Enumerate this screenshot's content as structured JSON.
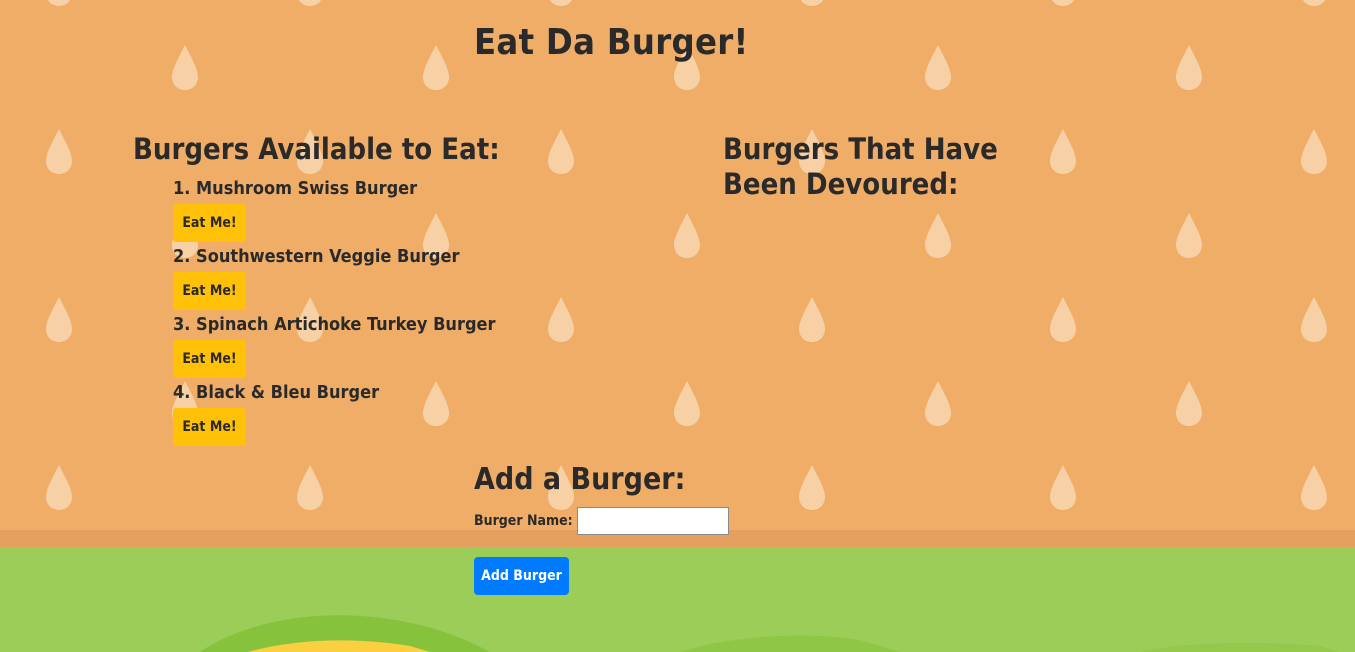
{
  "page": {
    "title": "Eat Da Burger!"
  },
  "available": {
    "heading": "Burgers Available to Eat:",
    "items": [
      {
        "name": "1. Mushroom Swiss Burger",
        "button": "Eat Me!"
      },
      {
        "name": "2. Southwestern Veggie Burger",
        "button": "Eat Me!"
      },
      {
        "name": "3. Spinach Artichoke Turkey Burger",
        "button": "Eat Me!"
      },
      {
        "name": "4. Black & Bleu Burger",
        "button": "Eat Me!"
      }
    ]
  },
  "devoured": {
    "heading": "Burgers That Have Been Devoured:",
    "items": []
  },
  "add_form": {
    "heading": "Add a Burger:",
    "label": "Burger Name:",
    "input_value": "",
    "submit_label": "Add Burger"
  },
  "colors": {
    "bun": "#f0ad68",
    "seed": "#f8d0a6",
    "lettuce": "#9ccd58",
    "eat_button": "#ffc107",
    "add_button": "#007bff"
  }
}
